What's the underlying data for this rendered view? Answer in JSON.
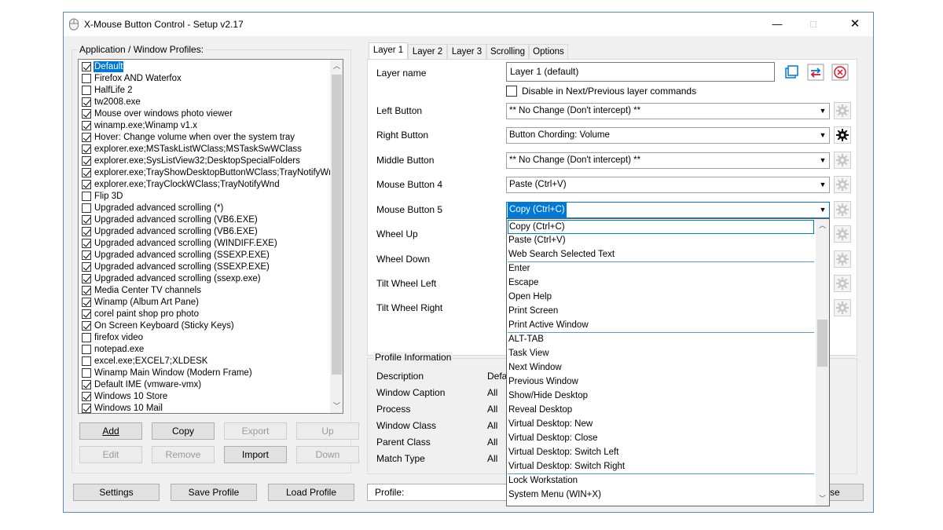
{
  "window": {
    "title": "X-Mouse Button Control - Setup v2.17",
    "minimize": "—",
    "maximize": "□",
    "close": "✕"
  },
  "profiles": {
    "group_label": "Application / Window Profiles:",
    "items": [
      {
        "label": "Default",
        "checked": true,
        "selected": true
      },
      {
        "label": "Firefox AND Waterfox",
        "checked": false
      },
      {
        "label": "HalfLife 2",
        "checked": false
      },
      {
        "label": "tw2008.exe",
        "checked": true
      },
      {
        "label": "Mouse over windows photo viewer",
        "checked": true
      },
      {
        "label": "winamp.exe;Winamp v1.x",
        "checked": true
      },
      {
        "label": "Hover: Change volume when over the system tray",
        "checked": true
      },
      {
        "label": "explorer.exe;MSTaskListWClass;MSTaskSwWClass",
        "checked": true
      },
      {
        "label": "explorer.exe;SysListView32;DesktopSpecialFolders",
        "checked": true
      },
      {
        "label": "explorer.exe;TrayShowDesktopButtonWClass;TrayNotifyWnd",
        "checked": true
      },
      {
        "label": "explorer.exe;TrayClockWClass;TrayNotifyWnd",
        "checked": true
      },
      {
        "label": "Flip 3D",
        "checked": false
      },
      {
        "label": "Upgraded advanced scrolling (*)",
        "checked": false
      },
      {
        "label": "Upgraded advanced scrolling (VB6.EXE)",
        "checked": true
      },
      {
        "label": "Upgraded advanced scrolling (VB6.EXE)",
        "checked": true
      },
      {
        "label": "Upgraded advanced scrolling (WINDIFF.EXE)",
        "checked": true
      },
      {
        "label": "Upgraded advanced scrolling (SSEXP.EXE)",
        "checked": true
      },
      {
        "label": "Upgraded advanced scrolling (SSEXP.EXE)",
        "checked": true
      },
      {
        "label": "Upgraded advanced scrolling (ssexp.exe)",
        "checked": true
      },
      {
        "label": "Media Center TV channels",
        "checked": true
      },
      {
        "label": "Winamp (Album Art Pane)",
        "checked": true
      },
      {
        "label": "corel paint shop pro photo",
        "checked": true
      },
      {
        "label": "On Screen Keyboard (Sticky Keys)",
        "checked": true
      },
      {
        "label": "firefox video",
        "checked": false
      },
      {
        "label": "notepad.exe",
        "checked": false
      },
      {
        "label": "excel.exe;EXCEL7;XLDESK",
        "checked": false
      },
      {
        "label": "Winamp Main Window (Modern Frame)",
        "checked": false
      },
      {
        "label": "Default IME (vmware-vmx)",
        "checked": true
      },
      {
        "label": "Windows 10 Store",
        "checked": true
      },
      {
        "label": "Windows 10 Mail",
        "checked": true
      }
    ],
    "scroll_fraction": 0.85
  },
  "profile_buttons": {
    "add": "Add",
    "copy": "Copy",
    "export": "Export",
    "up": "Up",
    "edit": "Edit",
    "remove": "Remove",
    "import": "Import",
    "down": "Down"
  },
  "bottom_buttons": {
    "settings": "Settings",
    "save_profile": "Save Profile",
    "load_profile": "Load Profile"
  },
  "tabs": [
    "Layer 1",
    "Layer 2",
    "Layer 3",
    "Scrolling",
    "Options"
  ],
  "layer": {
    "name_label": "Layer name",
    "name_value": "Layer 1 (default)",
    "disable_label": "Disable in Next/Previous layer commands",
    "buttons": [
      {
        "label": "Left Button",
        "value": "** No Change (Don't intercept) **"
      },
      {
        "label": "Right Button",
        "value": "Button Chording: Volume"
      },
      {
        "label": "Middle Button",
        "value": "** No Change (Don't intercept) **"
      },
      {
        "label": "Mouse Button 4",
        "value": "Paste (Ctrl+V)"
      },
      {
        "label": "Mouse Button 5",
        "value": "Copy (Ctrl+C)"
      },
      {
        "label": "Wheel Up",
        "value": ""
      },
      {
        "label": "Wheel Down",
        "value": ""
      },
      {
        "label": "Tilt Wheel Left",
        "value": ""
      },
      {
        "label": "Tilt Wheel Right",
        "value": ""
      }
    ]
  },
  "dropdown": {
    "items": [
      "Copy (Ctrl+C)",
      "Paste (Ctrl+V)",
      "Web Search Selected Text",
      "Enter",
      "Escape",
      "Open Help",
      "Print Screen",
      "Print Active Window",
      "ALT-TAB",
      "Task View",
      "Next Window",
      "Previous Window",
      "Show/Hide Desktop",
      "Reveal Desktop",
      "Virtual Desktop: New",
      "Virtual Desktop: Close",
      "Virtual Desktop: Switch Left",
      "Virtual Desktop: Switch Right",
      "Lock Workstation",
      "System Menu (WIN+X)"
    ],
    "highlighted": 0,
    "separators_after": [
      2,
      7,
      17
    ]
  },
  "profile_info": {
    "group_label": "Profile Information",
    "rows": [
      {
        "label": "Description",
        "value": "Defa"
      },
      {
        "label": "Window Caption",
        "value": "All"
      },
      {
        "label": "Process",
        "value": "All"
      },
      {
        "label": "Window Class",
        "value": "All"
      },
      {
        "label": "Parent Class",
        "value": "All"
      },
      {
        "label": "Match Type",
        "value": "All"
      }
    ]
  },
  "status": {
    "profile_label": "Profile:",
    "close_tail": "se"
  },
  "colors": {
    "selection": "#0078d7",
    "reset_icon": "#e81123",
    "copy_icon": "#0078d7",
    "swap_icon": "#0078d7"
  }
}
